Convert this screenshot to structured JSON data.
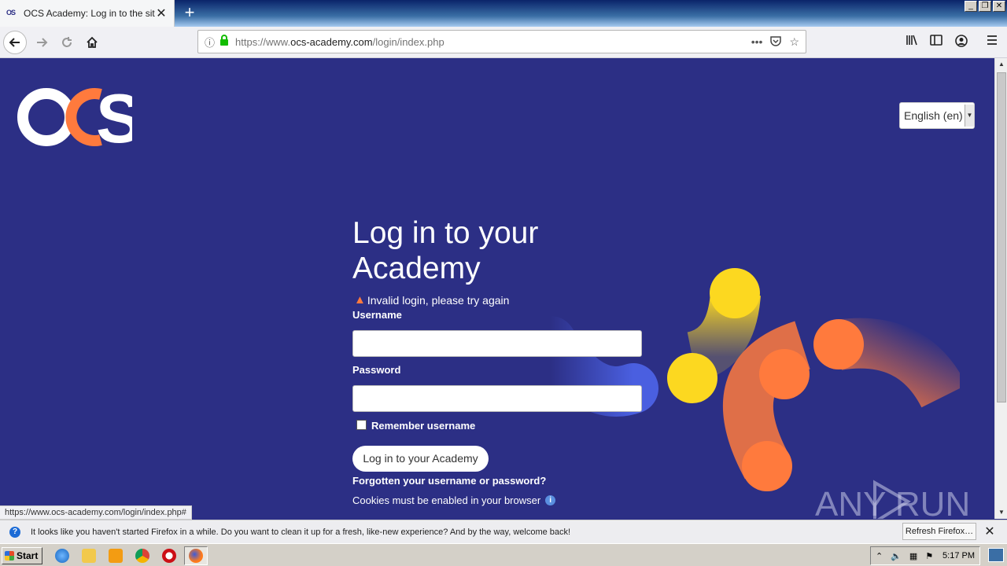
{
  "browser": {
    "tab_title": "OCS Academy: Log in to the site",
    "tab_favicon": "OS",
    "url_prefix": "https://www.",
    "url_host": "ocs-academy.com",
    "url_path": "/login/index.php",
    "status_url": "https://www.ocs-academy.com/login/index.php#"
  },
  "page": {
    "logo_text": "OCS",
    "language": "English (en)",
    "heading": "Log in to your Academy",
    "error_message": "Invalid login, please try again",
    "username_label": "Username",
    "password_label": "Password",
    "remember_label": "Remember username",
    "login_button": "Log in to your Academy",
    "forgot_link": "Forgotten your username or password?",
    "cookies_notice": "Cookies must be enabled in your browser",
    "colors": {
      "background": "#2c2f85",
      "orange": "#ff7a3d",
      "yellow": "#fcd820",
      "blue": "#4a5fe0"
    }
  },
  "notification": {
    "text": "It looks like you haven't started Firefox in a while. Do you want to clean it up for a fresh, like-new experience? And by the way, welcome back!",
    "button": "Refresh Firefox…"
  },
  "taskbar": {
    "start": "Start",
    "clock": "5:17 PM"
  },
  "watermark": "ANY RUN",
  "icons": [
    "back-arrow-icon",
    "forward-arrow-icon",
    "reload-icon",
    "home-icon",
    "info-icon",
    "lock-icon",
    "more-icon",
    "pocket-icon",
    "star-icon",
    "library-icon",
    "sidebar-icon",
    "account-icon",
    "menu-icon",
    "warning-icon"
  ]
}
